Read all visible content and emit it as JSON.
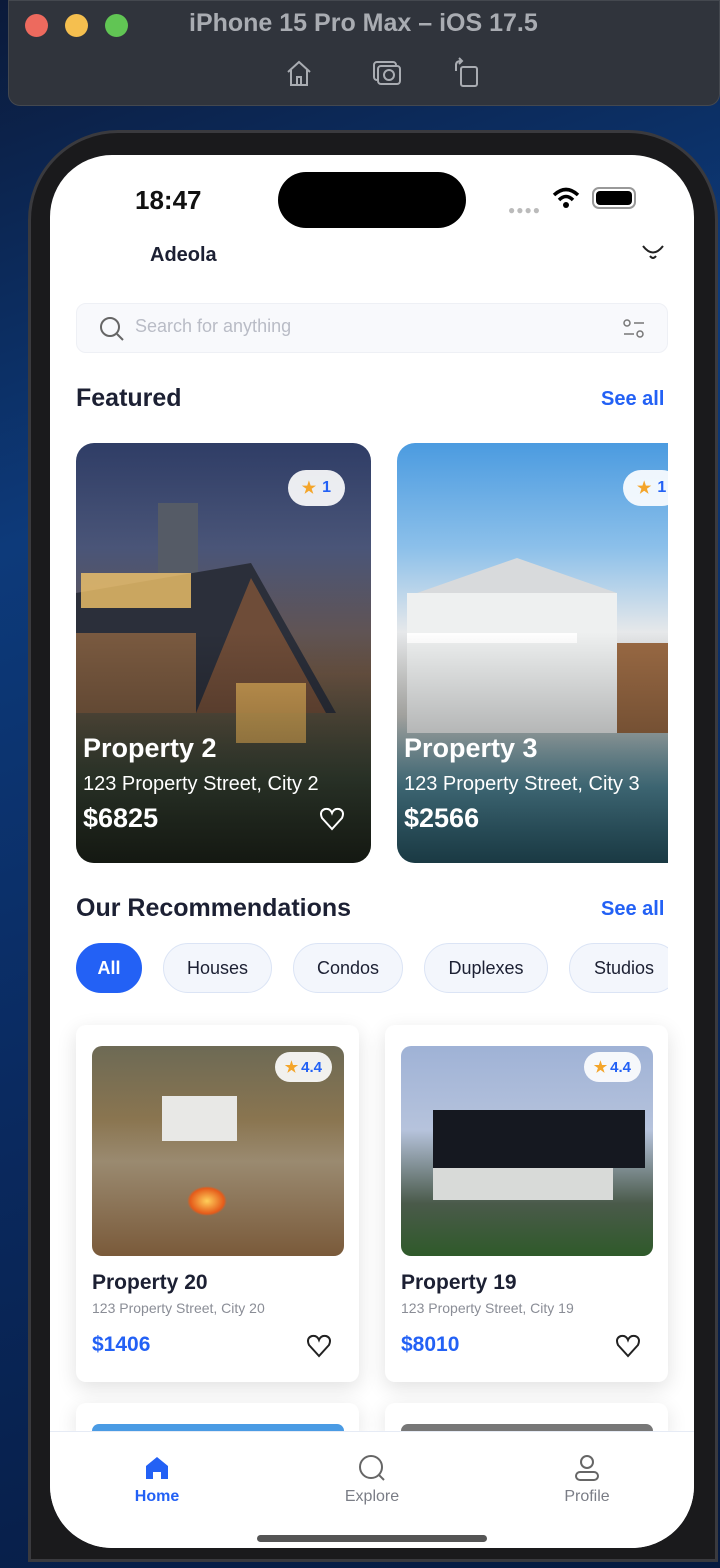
{
  "window": {
    "title": "iPhone 15 Pro Max – iOS 17.5",
    "controls": [
      "home-icon",
      "screenshot-icon",
      "rotate-icon"
    ]
  },
  "status": {
    "time": "18:47"
  },
  "header": {
    "user_name": "Adeola"
  },
  "search": {
    "placeholder": "Search for anything"
  },
  "featured": {
    "title": "Featured",
    "see_all": "See all",
    "items": [
      {
        "rating": "1",
        "title": "Property 2",
        "address": "123 Property Street, City 2",
        "price": "$6825"
      },
      {
        "rating": "1",
        "title": "Property 3",
        "address": "123 Property Street, City 3",
        "price": "$2566"
      }
    ]
  },
  "recommendations": {
    "title": "Our Recommendations",
    "see_all": "See all",
    "filters": [
      "All",
      "Houses",
      "Condos",
      "Duplexes",
      "Studios"
    ],
    "items": [
      {
        "rating": "4.4",
        "title": "Property 20",
        "address": "123 Property Street, City 20",
        "price": "$1406"
      },
      {
        "rating": "4.4",
        "title": "Property 19",
        "address": "123 Property Street, City 19",
        "price": "$8010"
      }
    ]
  },
  "tabs": [
    {
      "label": "Home",
      "active": true
    },
    {
      "label": "Explore"
    },
    {
      "label": "Profile"
    }
  ],
  "colors": {
    "accent": "#2361f5",
    "star": "#f4a52a",
    "text": "#1c2033"
  }
}
